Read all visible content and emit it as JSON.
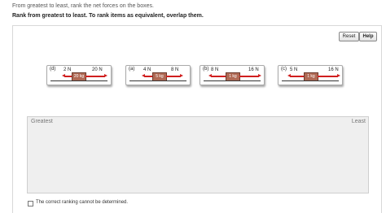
{
  "instructions": {
    "line1": "From greatest to least, rank the net forces on the boxes.",
    "line2": "Rank from greatest to least. To rank items as equivalent, overlap them."
  },
  "toolbar": {
    "reset_label": "Reset",
    "help_label": "Help"
  },
  "items": [
    {
      "label": "(d)",
      "left_force": "2 N",
      "right_force": "20 N",
      "mass": "20 kg"
    },
    {
      "label": "(a)",
      "left_force": "4 N",
      "right_force": "8 N",
      "mass": "5 kg"
    },
    {
      "label": "(b)",
      "left_force": "8 N",
      "right_force": "16 N",
      "mass": "1 kg"
    },
    {
      "label": "(c)",
      "left_force": "5 N",
      "right_force": "16 N",
      "mass": "1 kg"
    }
  ],
  "ranking": {
    "greatest_label": "Greatest",
    "least_label": "Least"
  },
  "equal_option": {
    "label": "The correct ranking cannot be determined."
  },
  "colors": {
    "arrow": "#d01f1f",
    "box": "#b06a55"
  }
}
